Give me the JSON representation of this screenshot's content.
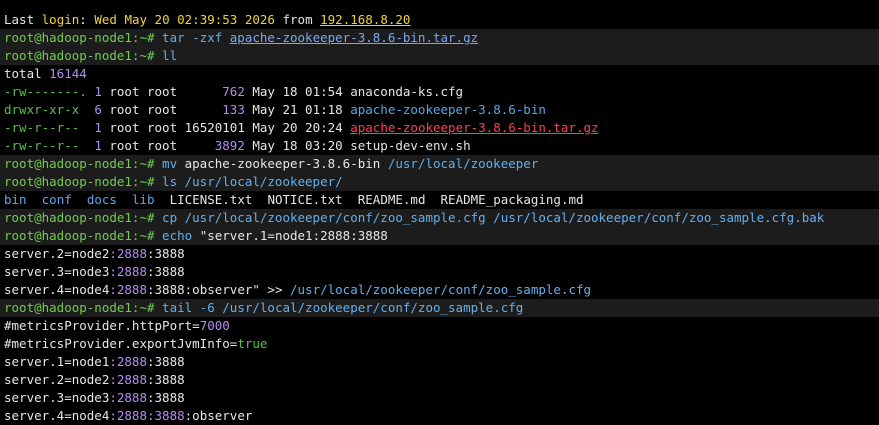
{
  "terminal": {
    "colors": {
      "background": "#000000",
      "command_line_background": "#1c1c1c",
      "prompt": "#6fce4f",
      "command": "#62b0f0",
      "directory": "#5aa6e8",
      "archive": "#ff3c5a",
      "number": "#b48cf2",
      "keyword": "#f0d43a",
      "boolean": "#54c242"
    },
    "lines": [
      {
        "cmd": false,
        "segments": [
          {
            "t": "Last ",
            "c": "fg"
          },
          {
            "t": "login",
            "c": "yellow"
          },
          {
            "t": ": ",
            "c": "fg"
          },
          {
            "t": "Wed May 20 02:39:53 2026",
            "c": "yellow"
          },
          {
            "t": " from ",
            "c": "fg"
          },
          {
            "t": "192.168.8.20",
            "c": "yellow-u"
          }
        ]
      },
      {
        "cmd": true,
        "segments": [
          {
            "t": "root@hadoop-node1:~# ",
            "c": "prompt"
          },
          {
            "t": "tar -zxf ",
            "c": "cmd"
          },
          {
            "t": "apache-zookeeper-3.8.6-bin.tar.gz",
            "c": "link"
          }
        ]
      },
      {
        "cmd": true,
        "segments": [
          {
            "t": "root@hadoop-node1:~# ",
            "c": "prompt"
          },
          {
            "t": "ll",
            "c": "cmd"
          }
        ]
      },
      {
        "cmd": false,
        "segments": [
          {
            "t": "total ",
            "c": "fg"
          },
          {
            "t": "16144",
            "c": "violet"
          }
        ]
      },
      {
        "cmd": false,
        "segments": [
          {
            "t": "-rw-------. ",
            "c": "green"
          },
          {
            "t": "1",
            "c": "violet"
          },
          {
            "t": " root root      ",
            "c": "fg"
          },
          {
            "t": "762",
            "c": "violet"
          },
          {
            "t": " May 18 01:54 anaconda-ks.cfg",
            "c": "fg"
          }
        ]
      },
      {
        "cmd": false,
        "segments": [
          {
            "t": "drwxr-xr-x  ",
            "c": "green"
          },
          {
            "t": "6",
            "c": "violet"
          },
          {
            "t": " root root      ",
            "c": "fg"
          },
          {
            "t": "133",
            "c": "violet"
          },
          {
            "t": " May 21 01:18 ",
            "c": "fg"
          },
          {
            "t": "apache-zookeeper-3.8.6-bin",
            "c": "path"
          }
        ]
      },
      {
        "cmd": false,
        "segments": [
          {
            "t": "-rw-r--r--  ",
            "c": "green"
          },
          {
            "t": "1",
            "c": "violet"
          },
          {
            "t": " root root ",
            "c": "fg"
          },
          {
            "t": "16520101",
            "c": "fg"
          },
          {
            "t": " May 20 20:24 ",
            "c": "fg"
          },
          {
            "t": "apache-zookeeper-3.8.6-bin.tar.gz",
            "c": "red"
          }
        ]
      },
      {
        "cmd": false,
        "segments": [
          {
            "t": "-rw-r--r--  ",
            "c": "green"
          },
          {
            "t": "1",
            "c": "violet"
          },
          {
            "t": " root root     ",
            "c": "fg"
          },
          {
            "t": "3892",
            "c": "violet"
          },
          {
            "t": " May 18 03:20 setup-dev-env.sh",
            "c": "fg"
          }
        ]
      },
      {
        "cmd": true,
        "segments": [
          {
            "t": "root@hadoop-node1:~# ",
            "c": "prompt"
          },
          {
            "t": "mv ",
            "c": "cmd"
          },
          {
            "t": "apache-zookeeper-3.8.6-bin ",
            "c": "fg"
          },
          {
            "t": "/usr/local/zookeeper",
            "c": "cmd"
          }
        ]
      },
      {
        "cmd": true,
        "segments": [
          {
            "t": "root@hadoop-node1:~# ",
            "c": "prompt"
          },
          {
            "t": "ls ",
            "c": "cmd"
          },
          {
            "t": "/usr/local/zookeeper/",
            "c": "cmd"
          }
        ]
      },
      {
        "cmd": false,
        "segments": [
          {
            "t": "bin",
            "c": "path"
          },
          {
            "t": "  ",
            "c": "fg"
          },
          {
            "t": "conf",
            "c": "path"
          },
          {
            "t": "  ",
            "c": "fg"
          },
          {
            "t": "docs",
            "c": "path"
          },
          {
            "t": "  ",
            "c": "fg"
          },
          {
            "t": "lib",
            "c": "path"
          },
          {
            "t": "  LICENSE.txt  NOTICE.txt  README.md  README_packaging.md",
            "c": "fg"
          }
        ]
      },
      {
        "cmd": true,
        "segments": [
          {
            "t": "root@hadoop-node1:~# ",
            "c": "prompt"
          },
          {
            "t": "cp ",
            "c": "cmd"
          },
          {
            "t": "/usr/local/zookeeper/conf/zoo_sample.cfg /usr/local/zookeeper/conf/zoo_sample.cfg.bak",
            "c": "cmd"
          }
        ]
      },
      {
        "cmd": true,
        "segments": [
          {
            "t": "root@hadoop-node1:~# ",
            "c": "prompt"
          },
          {
            "t": "echo ",
            "c": "cmd"
          },
          {
            "t": "\"server.1=node1:2888:3888",
            "c": "fg"
          }
        ]
      },
      {
        "cmd": false,
        "segments": [
          {
            "t": "server.2=node2",
            "c": "fg"
          },
          {
            "t": ":2888",
            "c": "violet"
          },
          {
            "t": ":3888",
            "c": "fg"
          }
        ]
      },
      {
        "cmd": false,
        "segments": [
          {
            "t": "server.3=node3",
            "c": "fg"
          },
          {
            "t": ":2888",
            "c": "violet"
          },
          {
            "t": ":3888",
            "c": "fg"
          }
        ]
      },
      {
        "cmd": false,
        "segments": [
          {
            "t": "server.4=node4",
            "c": "fg"
          },
          {
            "t": ":2888",
            "c": "violet"
          },
          {
            "t": ":3888",
            "c": "fg"
          },
          {
            "t": ":observer\" >> ",
            "c": "fg"
          },
          {
            "t": "/usr/local/zookeeper/conf/zoo_sample.cfg",
            "c": "cmd"
          }
        ]
      },
      {
        "cmd": true,
        "segments": [
          {
            "t": "root@hadoop-node1:~# ",
            "c": "prompt"
          },
          {
            "t": "tail ",
            "c": "cmd"
          },
          {
            "t": "-6 ",
            "c": "cmd"
          },
          {
            "t": "/usr/local/zookeeper/conf/zoo_sample.cfg",
            "c": "cmd"
          }
        ]
      },
      {
        "cmd": false,
        "segments": [
          {
            "t": "#metricsProvider.httpPort",
            "c": "fg"
          },
          {
            "t": "=",
            "c": "fg"
          },
          {
            "t": "7000",
            "c": "violet"
          }
        ]
      },
      {
        "cmd": false,
        "segments": [
          {
            "t": "#metricsProvider.exportJvmInfo",
            "c": "fg"
          },
          {
            "t": "=",
            "c": "fg"
          },
          {
            "t": "true",
            "c": "green"
          }
        ]
      },
      {
        "cmd": false,
        "segments": [
          {
            "t": "server.1=node1",
            "c": "fg"
          },
          {
            "t": ":2888",
            "c": "violet"
          },
          {
            "t": ":3888",
            "c": "fg"
          }
        ]
      },
      {
        "cmd": false,
        "segments": [
          {
            "t": "server.2=node2",
            "c": "fg"
          },
          {
            "t": ":2888",
            "c": "violet"
          },
          {
            "t": ":3888",
            "c": "fg"
          }
        ]
      },
      {
        "cmd": false,
        "segments": [
          {
            "t": "server.3=node3",
            "c": "fg"
          },
          {
            "t": ":2888",
            "c": "violet"
          },
          {
            "t": ":3888",
            "c": "fg"
          }
        ]
      },
      {
        "cmd": false,
        "segments": [
          {
            "t": "server.4=node4",
            "c": "fg"
          },
          {
            "t": ":2888",
            "c": "violet"
          },
          {
            "t": ":3888",
            "c": "violet"
          },
          {
            "t": ":observer",
            "c": "fg"
          }
        ]
      }
    ]
  }
}
